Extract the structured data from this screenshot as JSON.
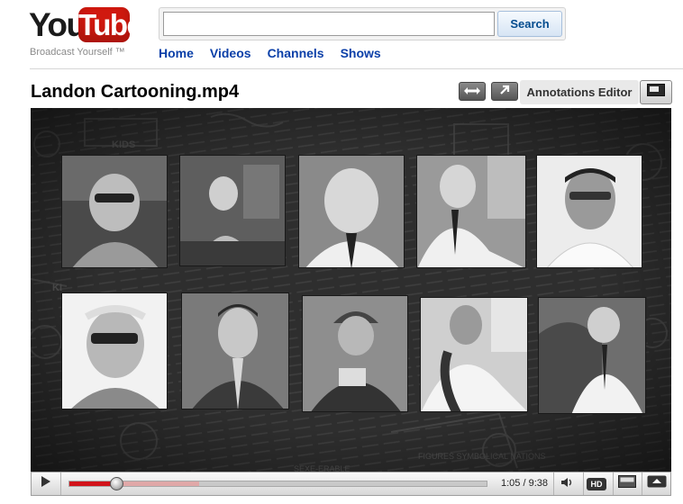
{
  "header": {
    "logo_you": "You",
    "logo_tube": "Tube",
    "logo_tagline": "Broadcast Yourself ™",
    "search": {
      "value": "",
      "placeholder": "",
      "button_label": "Search"
    },
    "nav": [
      "Home",
      "Videos",
      "Channels",
      "Shows"
    ]
  },
  "video": {
    "title": "Landon Cartooning.mp4",
    "annotations_label": "Annotations Editor",
    "photos_top": [
      "portrait-1",
      "portrait-2",
      "portrait-3",
      "portrait-4",
      "portrait-5"
    ],
    "photos_bottom": [
      "portrait-6",
      "portrait-7",
      "portrait-8",
      "portrait-9",
      "portrait-10"
    ]
  },
  "player": {
    "current_time": "1:05",
    "duration": "9:38",
    "time_display": "1:05 / 9:38",
    "played_fraction": 0.1125,
    "buffered_fraction": 0.31,
    "hd_label": "HD"
  },
  "colors": {
    "logo_red": "#d0190f",
    "nav_blue": "#0a3fa8",
    "progress_red": "#d2131a",
    "video_bg": "#2b2b2b"
  },
  "icons": [
    "play-icon",
    "volume-icon",
    "hd-icon",
    "widescreen-icon",
    "fullscreen-icon",
    "expand-icon",
    "popout-icon",
    "annotations-icon"
  ]
}
